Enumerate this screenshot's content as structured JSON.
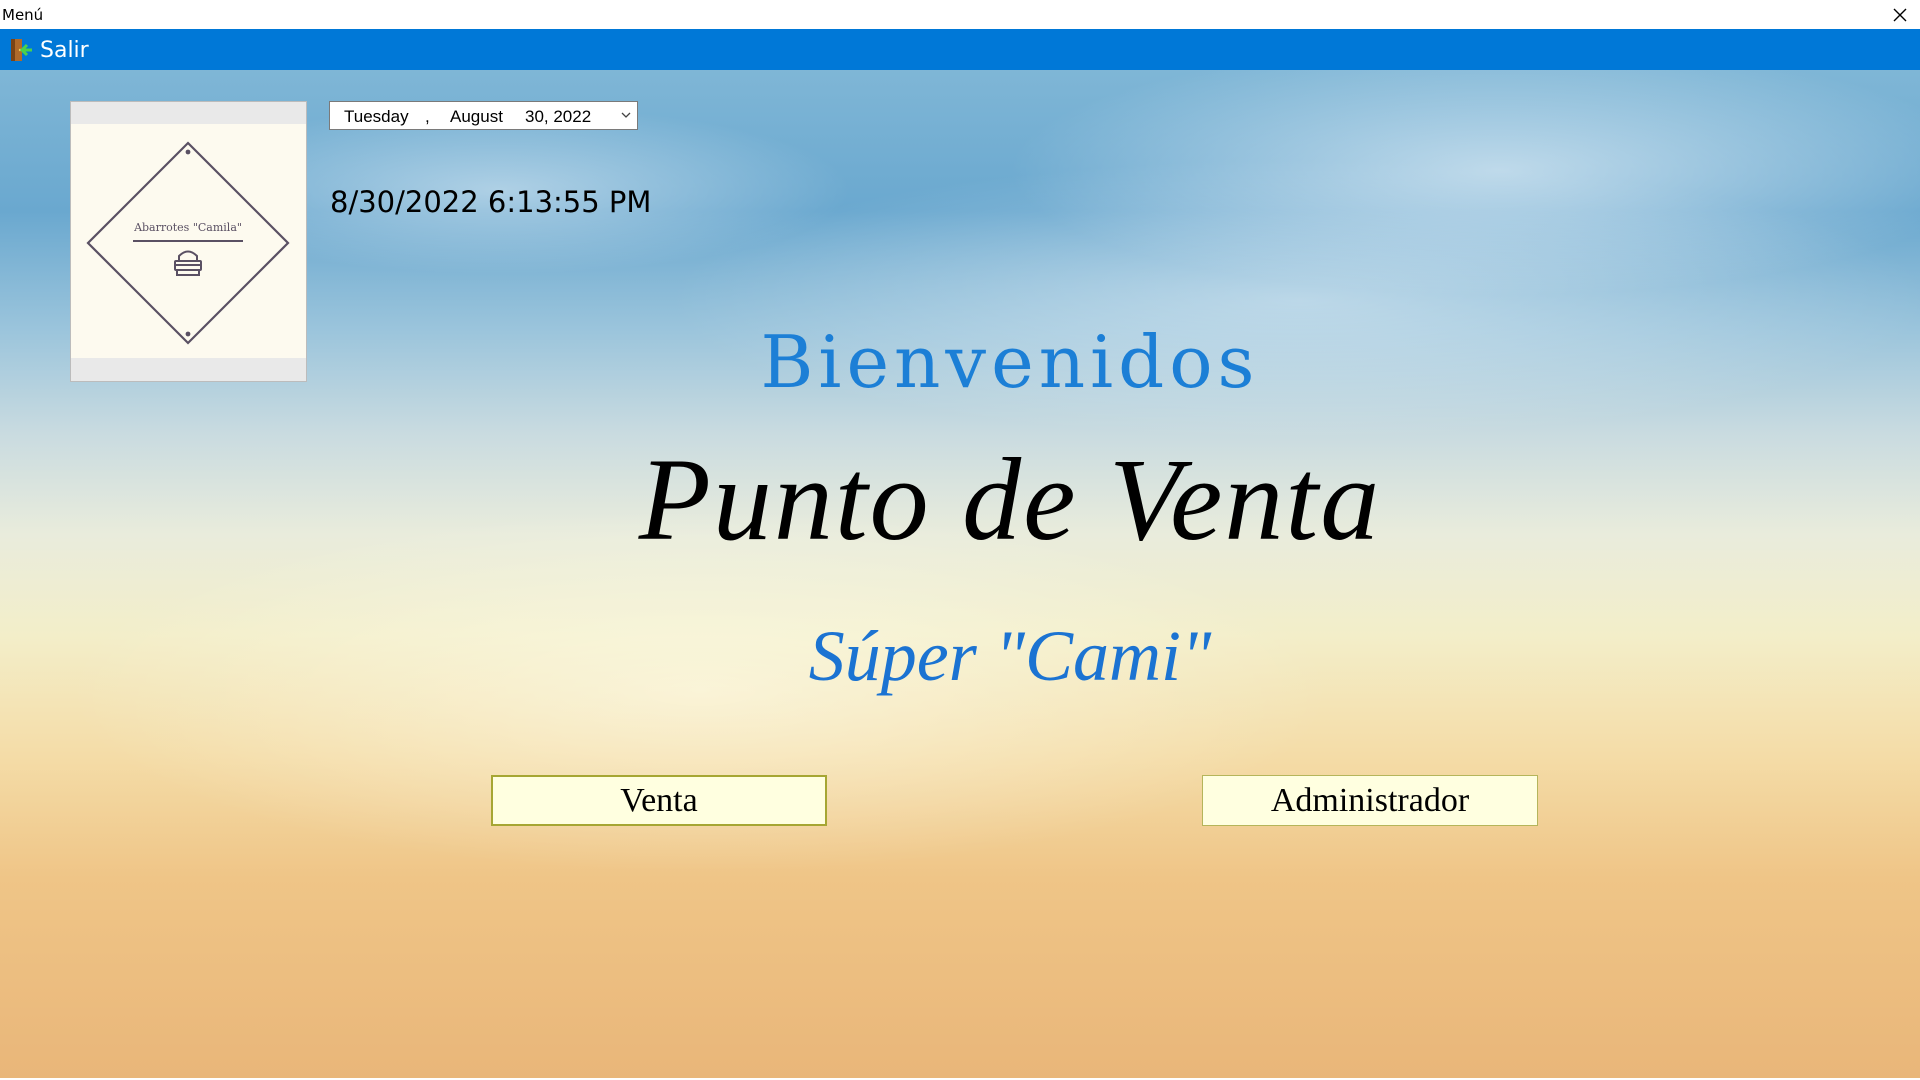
{
  "window": {
    "title": "Menú",
    "close_icon": "close-icon"
  },
  "menubar": {
    "exit_label": "Salir",
    "exit_icon": "exit-door-icon"
  },
  "logo": {
    "text": "Abarrotes \"Camila\"",
    "icon": "shopping-basket-icon"
  },
  "datepicker": {
    "day_of_week": "Tuesday",
    "separator": ",",
    "month": "August",
    "date_year": "30, 2022",
    "dropdown_icon": "chevron-down-icon"
  },
  "clock": {
    "datetime": "8/30/2022 6:13:55 PM"
  },
  "main": {
    "welcome": "Bienvenidos",
    "title": "Punto de Venta",
    "store_name": "Súper \"Cami\""
  },
  "buttons": {
    "venta_label": "Venta",
    "admin_label": "Administrador"
  },
  "colors": {
    "menubar": "#0078d7",
    "welcome_text": "#1c7fd6",
    "store_text": "#1b73d2",
    "button_bg": "#ffffe0"
  }
}
